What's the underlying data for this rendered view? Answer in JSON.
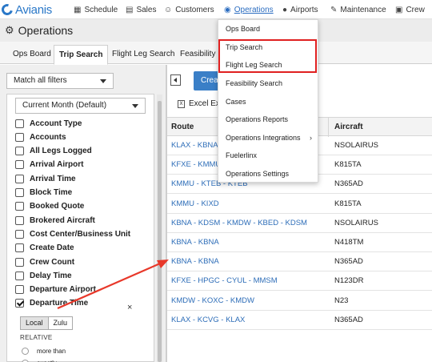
{
  "nav": {
    "logo": "Avianis",
    "items": [
      {
        "icon": "calendar-icon",
        "glyph": "▦",
        "label": "Schedule"
      },
      {
        "icon": "sales-icon",
        "glyph": "▤",
        "label": "Sales"
      },
      {
        "icon": "customers-icon",
        "glyph": "☺",
        "label": "Customers"
      },
      {
        "icon": "globe-icon",
        "glyph": "◉",
        "label": "Operations"
      },
      {
        "icon": "map-pin-icon",
        "glyph": "●",
        "label": "Airports"
      },
      {
        "icon": "wrench-icon",
        "glyph": "✎",
        "label": "Maintenance"
      },
      {
        "icon": "crew-icon",
        "glyph": "▣",
        "label": "Crew"
      }
    ]
  },
  "page": {
    "title": "Operations"
  },
  "tabs": [
    "Ops Board",
    "Trip Search",
    "Flight Leg Search",
    "Feasibility Se"
  ],
  "filters": {
    "match": "Match all filters",
    "period": "Current Month (Default)",
    "items": [
      {
        "label": "Account Type",
        "checked": false
      },
      {
        "label": "Accounts",
        "checked": false
      },
      {
        "label": "All Legs Logged",
        "checked": false
      },
      {
        "label": "Arrival Airport",
        "checked": false
      },
      {
        "label": "Arrival Time",
        "checked": false
      },
      {
        "label": "Block Time",
        "checked": false
      },
      {
        "label": "Booked Quote",
        "checked": false
      },
      {
        "label": "Brokered Aircraft",
        "checked": false
      },
      {
        "label": "Cost Center/Business Unit",
        "checked": false
      },
      {
        "label": "Create Date",
        "checked": false
      },
      {
        "label": "Crew Count",
        "checked": false
      },
      {
        "label": "Delay Time",
        "checked": false
      },
      {
        "label": "Departure Airport",
        "checked": false
      },
      {
        "label": "Departure Time",
        "checked": true
      }
    ],
    "close": "×",
    "tz_local": "Local",
    "tz_zulu": "Zulu",
    "relative_label": "RELATIVE",
    "radios": [
      "more than",
      "exactly"
    ]
  },
  "toolbar": {
    "create_label": "Crea",
    "excel_label": "Excel Ex"
  },
  "table": {
    "headers": {
      "route": "Route",
      "aircraft": "Aircraft"
    },
    "rows": [
      {
        "route": "KLAX - KBNA",
        "aircraft": "NSOLAIRUS"
      },
      {
        "route": "KFXE - KMMU",
        "aircraft": "K815TA"
      },
      {
        "route": "KMMU - KTEB - KTEB",
        "aircraft": "N365AD"
      },
      {
        "route": "KMMU - KIXD",
        "aircraft": "K815TA"
      },
      {
        "route": "KBNA - KDSM - KMDW - KBED - KDSM",
        "aircraft": "NSOLAIRUS"
      },
      {
        "route": "KBNA - KBNA",
        "aircraft": "N418TM"
      },
      {
        "route": "KBNA - KBNA",
        "aircraft": "N365AD"
      },
      {
        "route": "KFXE - HPGC - CYUL - MMSM",
        "aircraft": "N123DR"
      },
      {
        "route": "KMDW - KOXC - KMDW",
        "aircraft": "N23"
      },
      {
        "route": "KLAX - KCVG - KLAX",
        "aircraft": "N365AD"
      }
    ]
  },
  "menu": {
    "items": [
      {
        "label": "Ops Board",
        "submenu": false
      },
      {
        "label": "Trip Search",
        "submenu": false
      },
      {
        "label": "Flight Leg Search",
        "submenu": false
      },
      {
        "label": "Feasibility Search",
        "submenu": false
      },
      {
        "label": "Cases",
        "submenu": false
      },
      {
        "label": "Operations Reports",
        "submenu": false
      },
      {
        "label": "Operations Integrations",
        "submenu": true
      },
      {
        "label": "Fuelerlinx",
        "submenu": false
      },
      {
        "label": "Operations Settings",
        "submenu": false
      }
    ],
    "chevron": "›"
  },
  "colors": {
    "accent": "#2a6cc0",
    "link": "#2d6db8",
    "highlight": "#e02020",
    "arrow": "#e8382a"
  }
}
